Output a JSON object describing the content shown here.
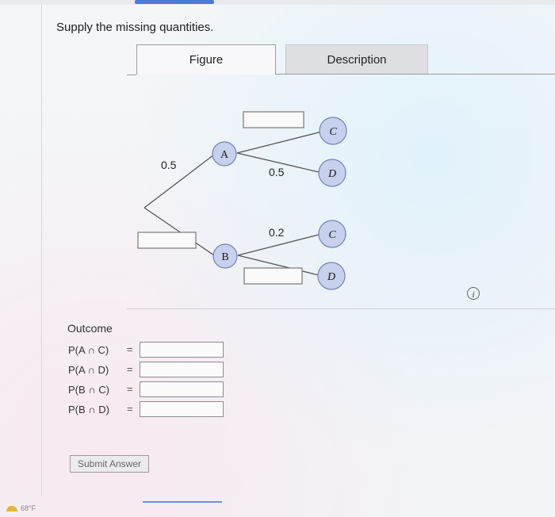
{
  "question": {
    "prompt": "Supply the missing quantities."
  },
  "tabs": [
    {
      "label": "Figure",
      "active": true
    },
    {
      "label": "Description",
      "active": false
    }
  ],
  "tree": {
    "branch_to_A_prob": "0.5",
    "branch_to_B_prob": "",
    "A_to_C_prob": "",
    "A_to_D_prob": "0.5",
    "B_to_C_prob": "0.2",
    "B_to_D_prob": "",
    "nodes": {
      "A": "A",
      "B": "B",
      "A_C": "C",
      "A_D": "D",
      "B_C": "C",
      "B_D": "D"
    },
    "colors": {
      "node_fill": "#c7d0ec",
      "node_stroke": "#7482b6",
      "branch": "#555555"
    }
  },
  "info_icon": {
    "glyph": "i"
  },
  "outcomes": {
    "title": "Outcome",
    "rows": [
      {
        "label": "P(A ∩ C)",
        "eq": "=",
        "value": ""
      },
      {
        "label": "P(A ∩ D)",
        "eq": "=",
        "value": ""
      },
      {
        "label": "P(B ∩ C)",
        "eq": "=",
        "value": ""
      },
      {
        "label": "P(B ∩ D)",
        "eq": "=",
        "value": ""
      }
    ]
  },
  "submit": {
    "label": "Submit Answer"
  },
  "taskbar": {
    "temperature": "68°F"
  }
}
